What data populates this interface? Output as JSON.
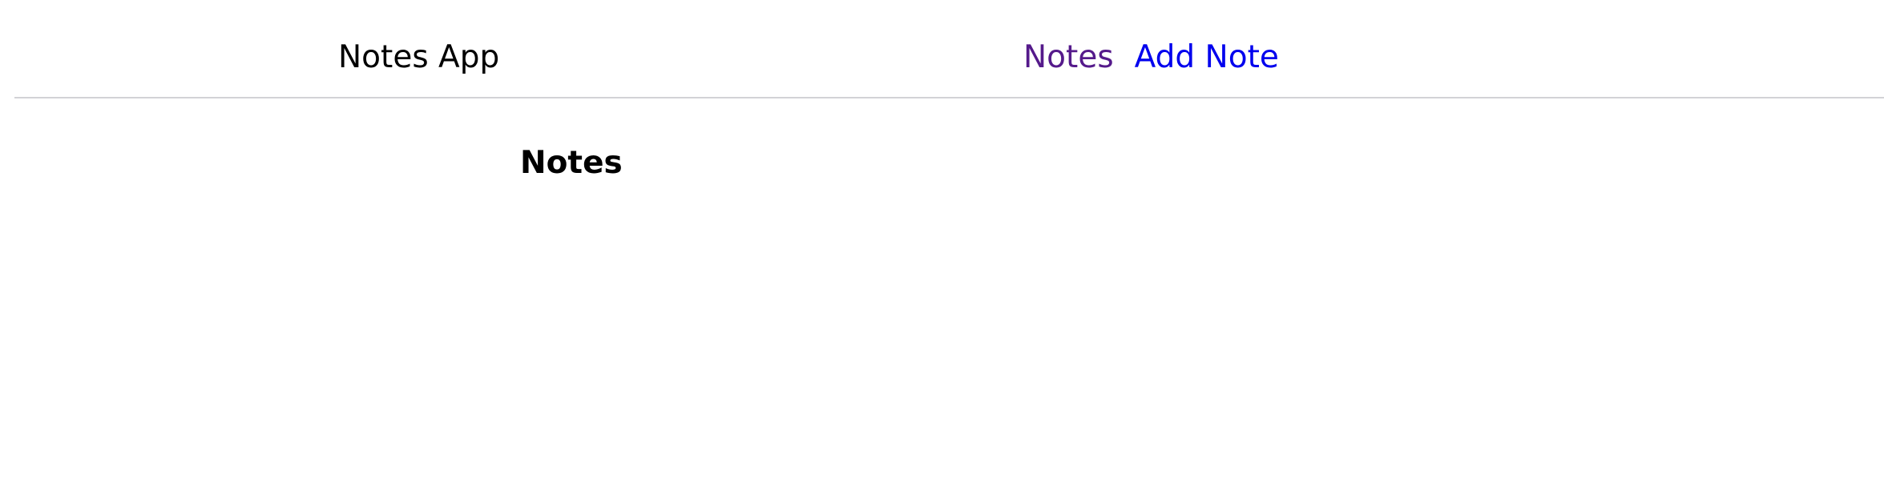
{
  "navbar": {
    "brand": "Notes App",
    "links": [
      {
        "label": "Notes",
        "color": "#551a8b"
      },
      {
        "label": "Add Note",
        "color": "#0000ee"
      }
    ]
  },
  "main": {
    "heading": "Notes"
  }
}
